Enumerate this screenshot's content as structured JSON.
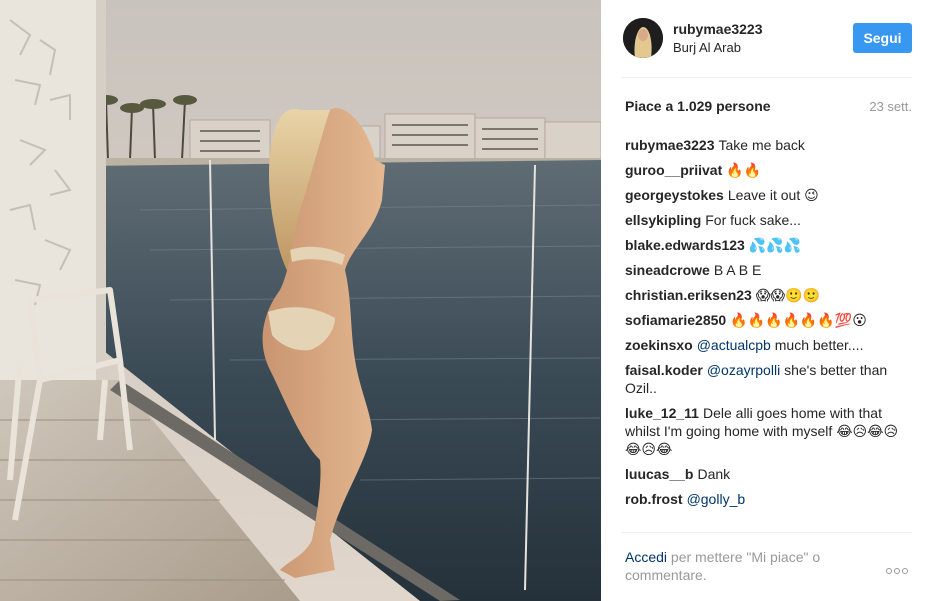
{
  "post": {
    "photo_icon": "photo",
    "username": "rubymae3223",
    "location": "Burj Al Arab",
    "follow_label": "Segui",
    "likes": "Piace a 1.029 persone",
    "date": "23 sett.",
    "comments": [
      {
        "user": "rubymae3223",
        "text": "Take me back ",
        "mention": ""
      },
      {
        "user": "guroo__priivat",
        "text": "🔥🔥",
        "mention": ""
      },
      {
        "user": "georgeystokes",
        "text": "Leave it out 😉",
        "mention": ""
      },
      {
        "user": "ellsykipling",
        "text": "For fuck sake...",
        "mention": ""
      },
      {
        "user": "blake.edwards123",
        "text": "💦💦💦",
        "mention": ""
      },
      {
        "user": "sineadcrowe",
        "text": "B A B E",
        "mention": ""
      },
      {
        "user": "christian.eriksen23",
        "text": "😱😱🙂🙂",
        "mention": ""
      },
      {
        "user": "sofiamarie2850",
        "text": "🔥🔥🔥🔥🔥🔥💯😮",
        "mention": ""
      },
      {
        "user": "zoekinsxo",
        "text": "much better....",
        "mention": "@actualcpb"
      },
      {
        "user": "faisal.koder",
        "text": "she's better than Ozil..",
        "mention": "@ozayrpolli"
      },
      {
        "user": "luke_12_11",
        "text": "Dele alli goes home with that whilst I'm going home with myself 😂😥😂😥😂😥😂",
        "mention": ""
      },
      {
        "user": "luucas__b",
        "text": "Dank",
        "mention": ""
      },
      {
        "user": "rob.frost",
        "text": "",
        "mention": "@golly_b"
      }
    ],
    "footer": {
      "login_link": "Accedi",
      "login_suffix": "per mettere \"Mi piace\" o commentare.",
      "more_icon": "more-options-icon"
    }
  }
}
